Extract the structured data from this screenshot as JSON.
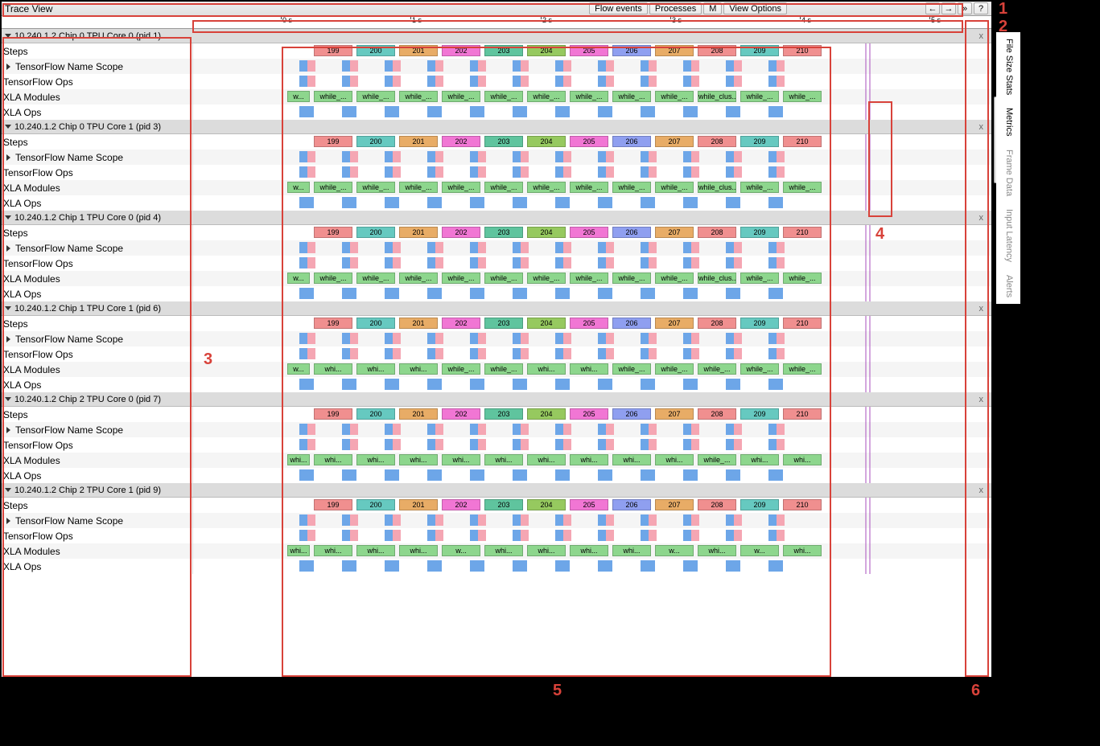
{
  "topbar": {
    "title": "Trace View",
    "flow_events": "Flow events",
    "processes": "Processes",
    "m": "M",
    "view_options": "View Options",
    "nav_back": "←",
    "nav_fwd": "→",
    "nav_more": "»",
    "help": "?"
  },
  "ruler": {
    "ticks": [
      "0 s",
      "1 s",
      "2 s",
      "3 s",
      "4 s",
      "5 s"
    ],
    "positions": [
      349,
      510,
      672,
      833,
      994,
      1155
    ]
  },
  "side_tabs": [
    "File Size Stats",
    "Metrics",
    "Frame Data",
    "Input Latency",
    "Alerts"
  ],
  "processes": [
    {
      "name": "10.240.1.2 Chip 0 TPU Core 0 (pid 1)",
      "xla_pattern": "a"
    },
    {
      "name": "10.240.1.2 Chip 0 TPU Core 1 (pid 3)",
      "xla_pattern": "a"
    },
    {
      "name": "10.240.1.2 Chip 1 TPU Core 0 (pid 4)",
      "xla_pattern": "a"
    },
    {
      "name": "10.240.1.2 Chip 1 TPU Core 1 (pid 6)",
      "xla_pattern": "b"
    },
    {
      "name": "10.240.1.2 Chip 2 TPU Core 0 (pid 7)",
      "xla_pattern": "c"
    },
    {
      "name": "10.240.1.2 Chip 2 TPU Core 1 (pid 9)",
      "xla_pattern": "d"
    }
  ],
  "row_labels": {
    "steps": "Steps",
    "tf_scope": "TensorFlow Name Scope",
    "tf_ops": "TensorFlow Ops",
    "xla_modules": "XLA Modules",
    "xla_ops": "XLA Ops"
  },
  "process_close": "x",
  "step_start": 199,
  "step_count": 12,
  "step_colors": [
    "#f08f8f",
    "#66c9c0",
    "#e8ac66",
    "#f176d4",
    "#5fc49e",
    "#96c95f",
    "#f176d4",
    "#8f9ff0",
    "#e8ac66",
    "#f08f8f",
    "#66c9c0",
    "#f08f8f"
  ],
  "xla_label_patterns": {
    "a": [
      "w...",
      "while_...",
      "while_...",
      "while_...",
      "while_...",
      "while_...",
      "while_...",
      "while_...",
      "while_...",
      "while_...",
      "while_clus...",
      "while_...",
      "while_..."
    ],
    "b": [
      "w...",
      "whi...",
      "whi...",
      "whi...",
      "while_...",
      "while_...",
      "whi...",
      "whi...",
      "while_...",
      "while_...",
      "while_...",
      "while_...",
      "while_..."
    ],
    "c": [
      "whi...",
      "whi...",
      "whi...",
      "whi...",
      "whi...",
      "whi...",
      "whi...",
      "whi...",
      "whi...",
      "whi...",
      "while_...",
      "whi...",
      "whi..."
    ],
    "d": [
      "whi...",
      "whi...",
      "whi...",
      "whi...",
      "w...",
      "whi...",
      "whi...",
      "whi...",
      "whi...",
      "w...",
      "whi...",
      "w...",
      "whi..."
    ]
  },
  "xla_color": "#8dd68d",
  "tools": [
    "pointer",
    "pan",
    "updown",
    "leftright"
  ],
  "tool_active": 1,
  "annotations": {
    "1": "1",
    "2": "2",
    "3": "3",
    "4": "4",
    "5": "5",
    "6": "6"
  },
  "small_colors": {
    "blue": "#6da6e8",
    "pink": "#f5a6b3"
  },
  "vlines": [
    1073,
    1078
  ]
}
